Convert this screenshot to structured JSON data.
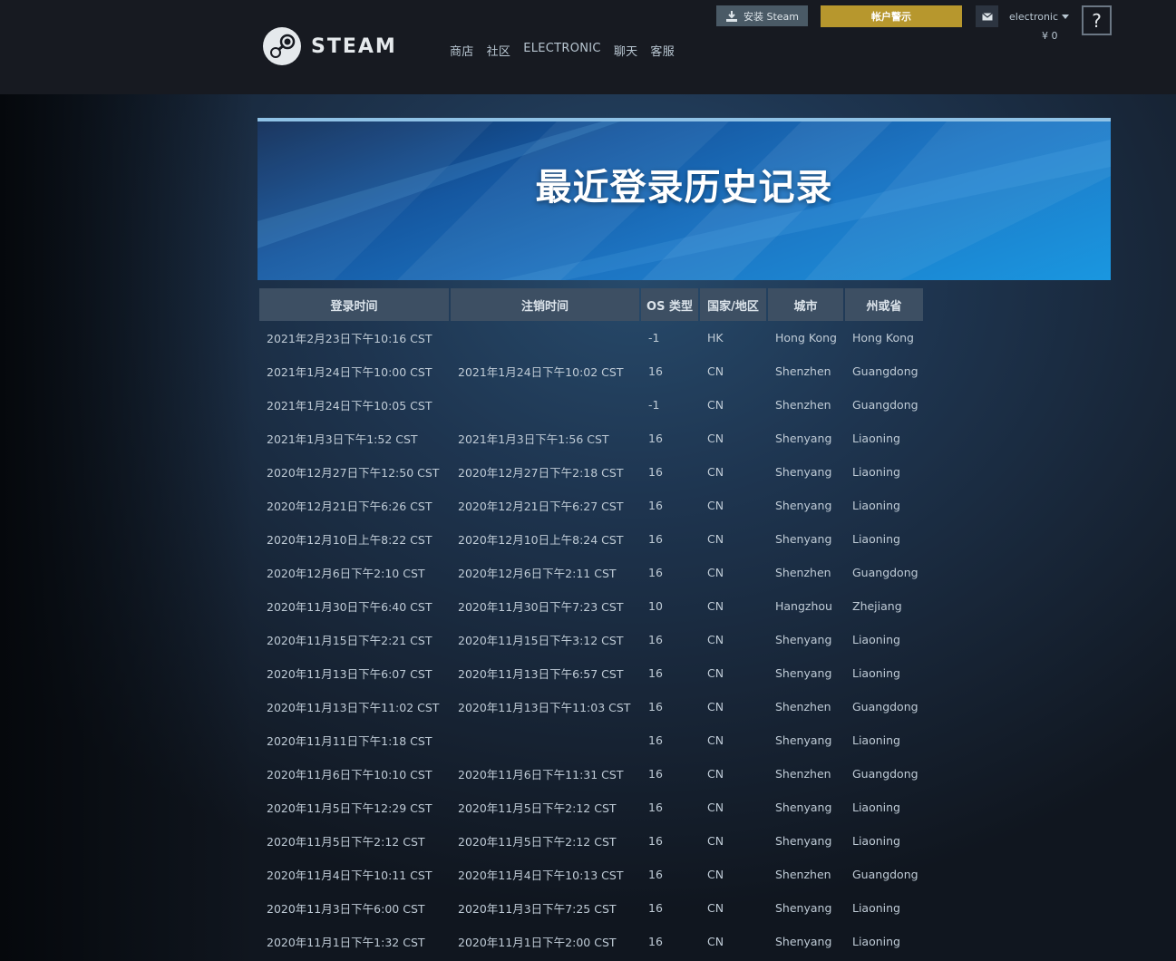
{
  "header": {
    "brand": "STEAM",
    "nav": [
      "商店",
      "社区",
      "ELECTRONIC",
      "聊天",
      "客服"
    ],
    "install_label": "安装 Steam",
    "alert_label": "帐户警示",
    "account_name": "electronic",
    "wallet": "¥ 0",
    "help_label": "?"
  },
  "banner": {
    "title": "最近登录历史记录"
  },
  "table": {
    "headers": [
      "登录时间",
      "注销时间",
      "OS 类型",
      "国家/地区",
      "城市",
      "州或省"
    ],
    "rows": [
      [
        "2021年2月23日下午10:16 CST",
        "",
        "-1",
        "HK",
        "Hong Kong",
        "Hong Kong"
      ],
      [
        "2021年1月24日下午10:00 CST",
        "2021年1月24日下午10:02 CST",
        "16",
        "CN",
        "Shenzhen",
        "Guangdong"
      ],
      [
        "2021年1月24日下午10:05 CST",
        "",
        "-1",
        "CN",
        "Shenzhen",
        "Guangdong"
      ],
      [
        "2021年1月3日下午1:52 CST",
        "2021年1月3日下午1:56 CST",
        "16",
        "CN",
        "Shenyang",
        "Liaoning"
      ],
      [
        "2020年12月27日下午12:50 CST",
        "2020年12月27日下午2:18 CST",
        "16",
        "CN",
        "Shenyang",
        "Liaoning"
      ],
      [
        "2020年12月21日下午6:26 CST",
        "2020年12月21日下午6:27 CST",
        "16",
        "CN",
        "Shenyang",
        "Liaoning"
      ],
      [
        "2020年12月10日上午8:22 CST",
        "2020年12月10日上午8:24 CST",
        "16",
        "CN",
        "Shenyang",
        "Liaoning"
      ],
      [
        "2020年12月6日下午2:10 CST",
        "2020年12月6日下午2:11 CST",
        "16",
        "CN",
        "Shenzhen",
        "Guangdong"
      ],
      [
        "2020年11月30日下午6:40 CST",
        "2020年11月30日下午7:23 CST",
        "10",
        "CN",
        "Hangzhou",
        "Zhejiang"
      ],
      [
        "2020年11月15日下午2:21 CST",
        "2020年11月15日下午3:12 CST",
        "16",
        "CN",
        "Shenyang",
        "Liaoning"
      ],
      [
        "2020年11月13日下午6:07 CST",
        "2020年11月13日下午6:57 CST",
        "16",
        "CN",
        "Shenyang",
        "Liaoning"
      ],
      [
        "2020年11月13日下午11:02 CST",
        "2020年11月13日下午11:03 CST",
        "16",
        "CN",
        "Shenzhen",
        "Guangdong"
      ],
      [
        "2020年11月11日下午1:18 CST",
        "",
        "16",
        "CN",
        "Shenyang",
        "Liaoning"
      ],
      [
        "2020年11月6日下午10:10 CST",
        "2020年11月6日下午11:31 CST",
        "16",
        "CN",
        "Shenzhen",
        "Guangdong"
      ],
      [
        "2020年11月5日下午12:29 CST",
        "2020年11月5日下午2:12 CST",
        "16",
        "CN",
        "Shenyang",
        "Liaoning"
      ],
      [
        "2020年11月5日下午2:12 CST",
        "2020年11月5日下午2:12 CST",
        "16",
        "CN",
        "Shenyang",
        "Liaoning"
      ],
      [
        "2020年11月4日下午10:11 CST",
        "2020年11月4日下午10:13 CST",
        "16",
        "CN",
        "Shenzhen",
        "Guangdong"
      ],
      [
        "2020年11月3日下午6:00 CST",
        "2020年11月3日下午7:25 CST",
        "16",
        "CN",
        "Shenyang",
        "Liaoning"
      ],
      [
        "2020年11月1日下午1:32 CST",
        "2020年11月1日下午2:00 CST",
        "16",
        "CN",
        "Shenyang",
        "Liaoning"
      ]
    ]
  },
  "colors": {
    "header_bg": "#171a21",
    "page_bg": "#1b2838",
    "alert": "#b7972d",
    "table_header": "#3d4f63"
  }
}
